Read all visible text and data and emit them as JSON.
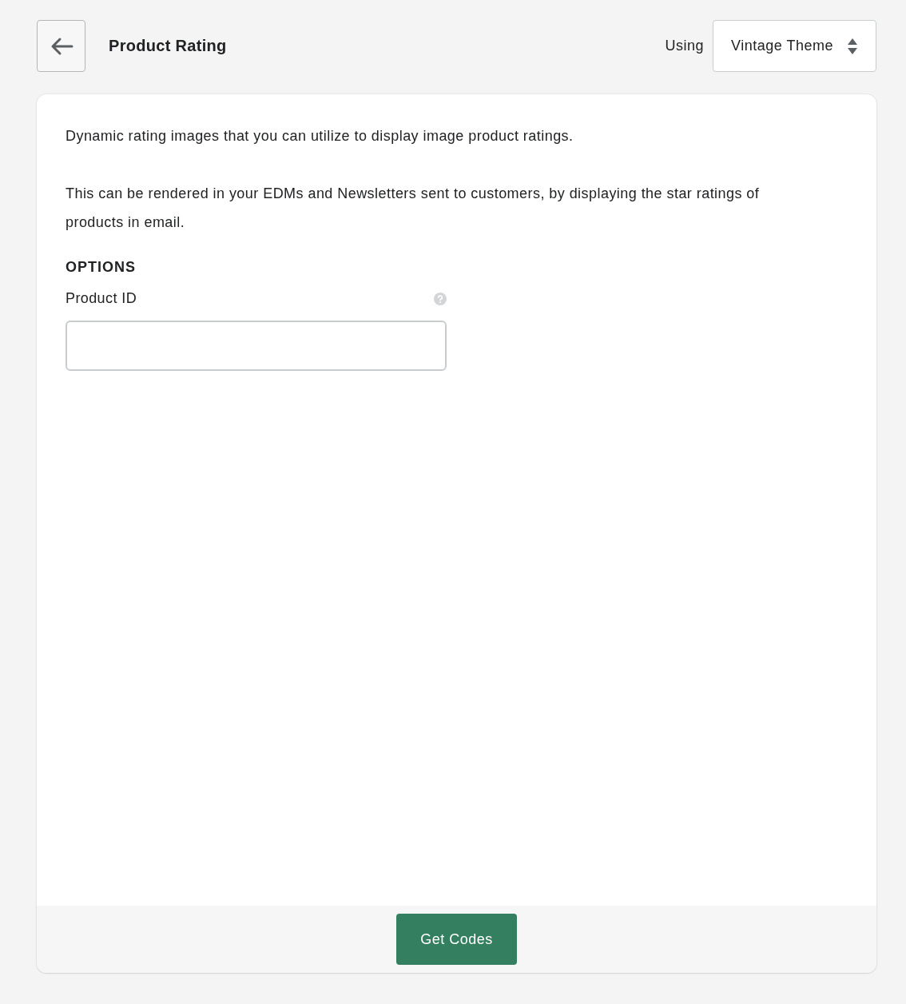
{
  "header": {
    "title": "Product Rating",
    "theme_label": "Using",
    "theme_select": {
      "value": "Vintage Theme"
    }
  },
  "card": {
    "paragraphs": [
      "Dynamic rating images that you can utilize to display image product ratings.",
      "This can be rendered in your EDMs and Newsletters sent to customers, by displaying the star ratings of products in email."
    ],
    "section_heading": "OPTIONS",
    "fields": [
      {
        "label": "Product ID"
      }
    ],
    "footer_button": "Get Codes"
  }
}
